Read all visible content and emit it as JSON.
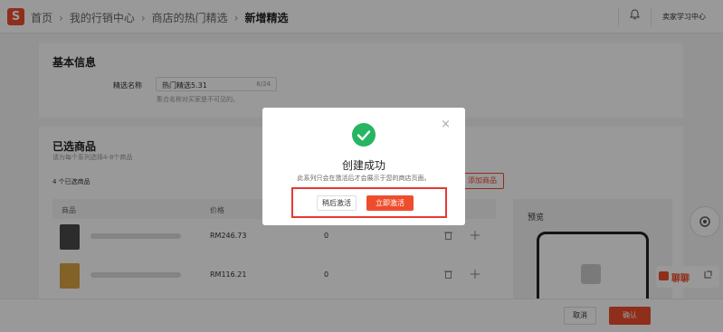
{
  "topbar": {
    "logo_glyph": "S",
    "breadcrumb": [
      "首页",
      "我的行销中心",
      "商店的热门精选",
      "新增精选"
    ],
    "separator": "›",
    "account": "卖家学习中心"
  },
  "basic_info": {
    "title": "基本信息",
    "name_label": "精选名称",
    "name_value": "热门精选5.31",
    "name_count": "8/24",
    "name_hint": "集合名称对买家是不可见的。"
  },
  "selected": {
    "title": "已选商品",
    "hint": "请为每个系列选择4-8个商品",
    "count_text": "4 个已选商品",
    "add_button": "添加商品",
    "columns": [
      "商品",
      "价格"
    ],
    "rows": [
      {
        "price": "RM246.73",
        "stock": "0",
        "thumb_color": "#4a4a4a"
      },
      {
        "price": "RM116.21",
        "stock": "0",
        "thumb_color": "#d9a441"
      }
    ]
  },
  "preview": {
    "title": "预览"
  },
  "chat": {
    "label": "聊聊"
  },
  "footer": {
    "cancel": "取消",
    "confirm": "确认"
  },
  "modal": {
    "title": "创建成功",
    "description": "此系列只会在激活后才会展示于您的商店页面。",
    "later_button": "稍后激活",
    "activate_button": "立即激活",
    "close_glyph": "×"
  },
  "colors": {
    "brand": "#ee4d2d",
    "success": "#26b562",
    "highlight": "#e53935"
  }
}
